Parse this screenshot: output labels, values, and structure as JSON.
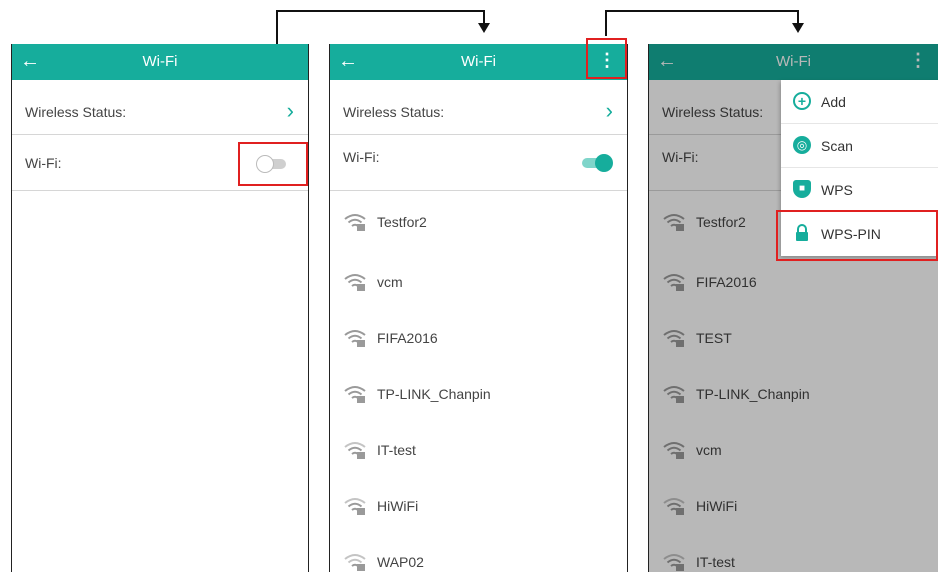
{
  "accent_color": "#16ad9c",
  "highlight_color": "#e02020",
  "screen1": {
    "title": "Wi-Fi",
    "back_icon": "back-arrow-icon",
    "wireless_status_label": "Wireless Status:",
    "wifi_label": "Wi-Fi:",
    "wifi_on": false
  },
  "screen2": {
    "title": "Wi-Fi",
    "back_icon": "back-arrow-icon",
    "menu_icon": "more-vertical-icon",
    "wireless_status_label": "Wireless Status:",
    "wifi_label": "Wi-Fi:",
    "wifi_on": true,
    "networks": [
      "Testfor2",
      "vcm",
      "FIFA2016",
      "TP-LINK_Chanpin",
      "IT-test",
      "HiWiFi",
      "WAP02"
    ]
  },
  "screen3": {
    "title": "Wi-Fi",
    "back_icon": "back-arrow-icon",
    "menu_icon": "more-vertical-icon",
    "wireless_status_label": "Wireless Status:",
    "wifi_label": "Wi-Fi:",
    "networks": [
      "Testfor2",
      "FIFA2016",
      "TEST",
      "TP-LINK_Chanpin",
      "vcm",
      "HiWiFi",
      "IT-test"
    ],
    "menu": [
      {
        "label": "Add",
        "icon": "plus-circle-icon"
      },
      {
        "label": "Scan",
        "icon": "scan-icon"
      },
      {
        "label": "WPS",
        "icon": "shield-icon"
      },
      {
        "label": "WPS-PIN",
        "icon": "lock-icon"
      }
    ]
  }
}
